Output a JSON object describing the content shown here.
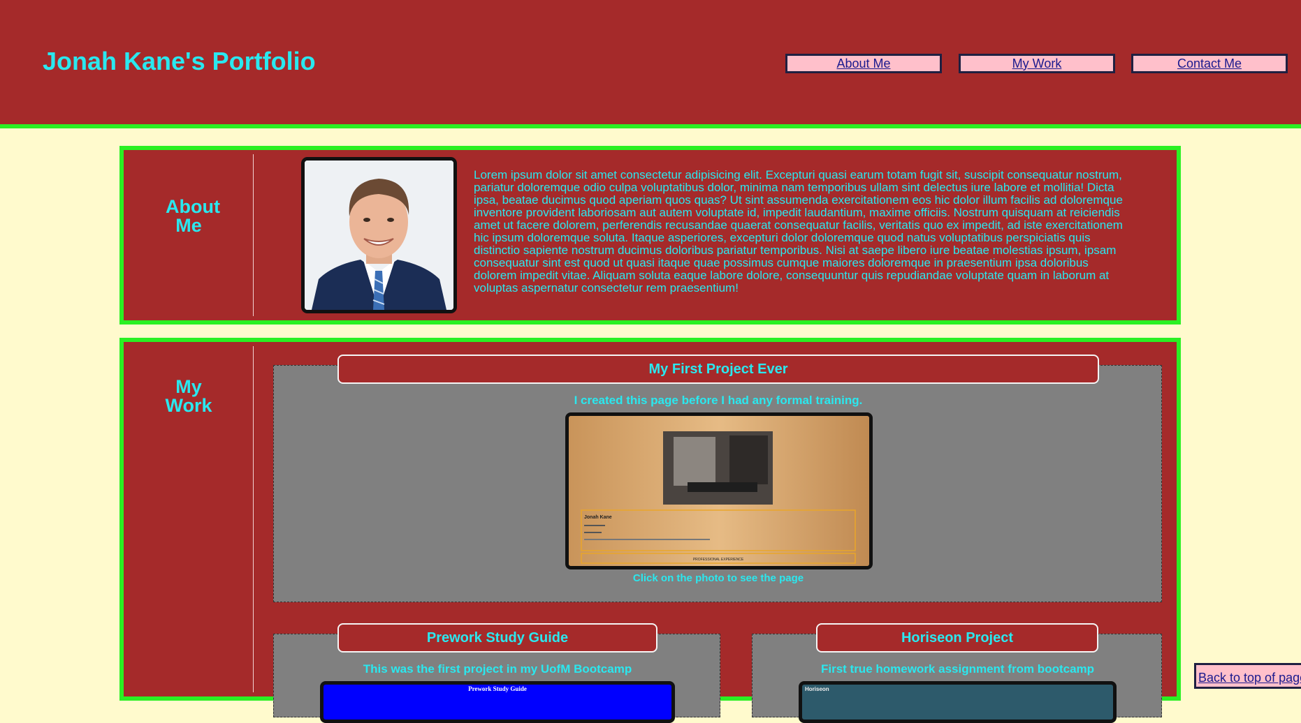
{
  "header": {
    "title": "Jonah Kane's Portfolio",
    "nav": [
      "About Me",
      "My Work",
      "Contact Me"
    ]
  },
  "about": {
    "heading_line1": "About",
    "heading_line2": "Me",
    "text": "Lorem ipsum dolor sit amet consectetur adipisicing elit. Excepturi quasi earum totam fugit sit, suscipit consequatur nostrum, pariatur doloremque odio culpa voluptatibus dolor, minima nam temporibus ullam sint delectus iure labore et mollitia! Dicta ipsa, beatae ducimus quod aperiam quos quas? Ut sint assumenda exercitationem eos hic dolor illum facilis ad doloremque inventore provident laboriosam aut autem voluptate id, impedit laudantium, maxime officiis. Nostrum quisquam at reiciendis amet ut facere dolorem, perferendis recusandae quaerat consequatur facilis, veritatis quo ex impedit, ad iste exercitationem hic ipsum doloremque soluta. Itaque asperiores, excepturi dolor doloremque quod natus voluptatibus perspiciatis quis distinctio sapiente nostrum ducimus doloribus pariatur temporibus. Nisi at saepe libero iure beatae molestias ipsum, ipsam consequatur sint est quod ut quasi itaque quae possimus cumque maiores doloremque in praesentium ipsa doloribus dolorem impedit vitae. Aliquam soluta eaque labore dolore, consequuntur quis repudiandae voluptate quam in laborum at voluptas aspernatur consectetur rem praesentium!"
  },
  "work": {
    "heading_line1": "My",
    "heading_line2": "Work",
    "projects": [
      {
        "title": "My First Project Ever",
        "desc": "I created this page before I had any formal training.",
        "note": "Click on the photo to see the page",
        "thumb_name": "Jonah Kane",
        "thumb_section": "PROFESSIONAL EXPERIENCE"
      },
      {
        "title": "Prework Study Guide",
        "desc": "This was the first project in my UofM Bootcamp",
        "thumb_title": "Prework Study Guide"
      },
      {
        "title": "Horiseon Project",
        "desc": "First true homework assignment from bootcamp",
        "thumb_title": "Horiseon"
      }
    ]
  },
  "back_to_top": "Back to top of page",
  "colors": {
    "header_bg": "#a52a2a",
    "accent_green": "#2af023",
    "cyan_text": "#2ae8ef",
    "page_bg": "#fffacd",
    "nav_bg": "#ffc0cb"
  }
}
